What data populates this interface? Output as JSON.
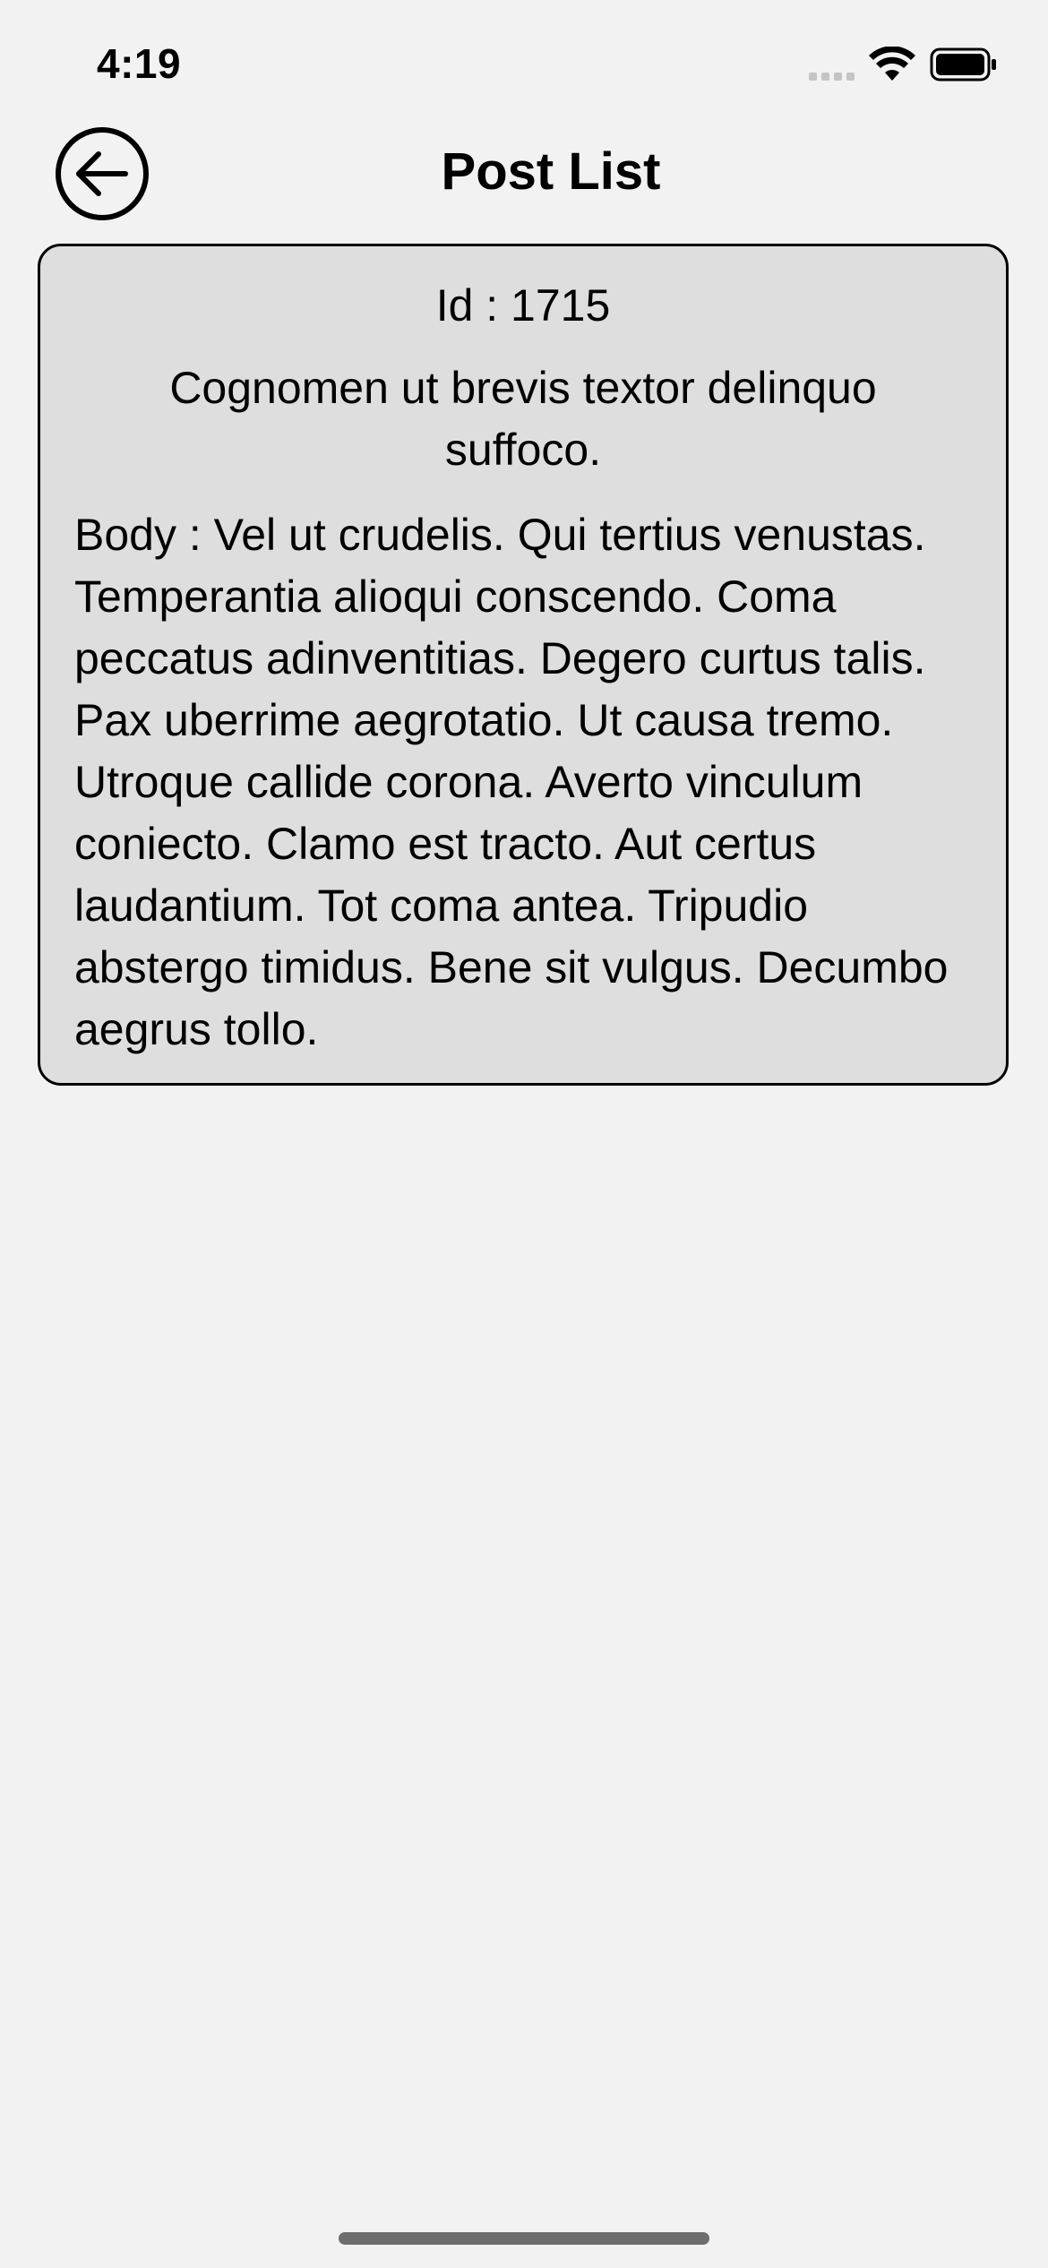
{
  "status_bar": {
    "time": "4:19"
  },
  "header": {
    "title": "Post List",
    "back_icon": "arrow-left-circle-icon"
  },
  "post": {
    "id_text": "Id : 1715",
    "title": "Cognomen ut brevis textor delinquo suffoco.",
    "body_text": "Body : Vel ut crudelis. Qui tertius venustas. Temperantia alioqui conscendo. Coma peccatus adinventitias. Degero curtus talis. Pax uberrime aegrotatio. Ut causa tremo. Utroque callide corona. Averto vinculum coniecto. Clamo est tracto. Aut certus laudantium. Tot coma antea. Tripudio abstergo timidus. Bene sit vulgus. Decumbo aegrus tollo."
  },
  "colors": {
    "background": "#f2f2f2",
    "card_background": "#dedede",
    "card_border": "#000000",
    "text": "#000000"
  }
}
